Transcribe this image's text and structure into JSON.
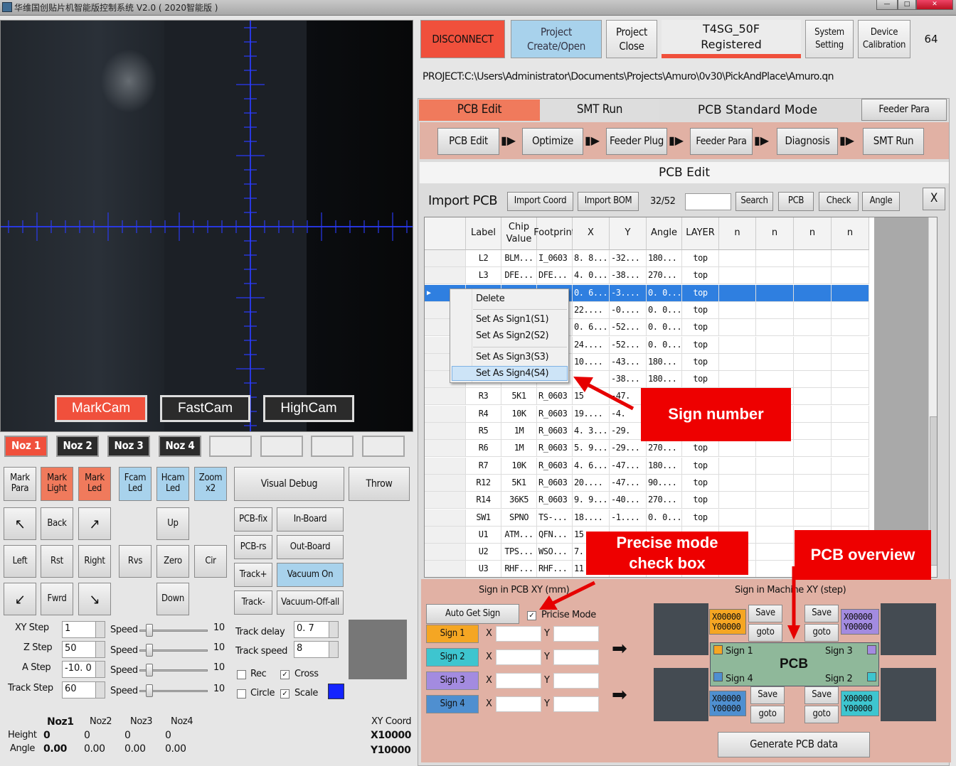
{
  "window": {
    "title": "华维国创贴片机智能版控制系统 V2.0 ( 2020智能版 )"
  },
  "camera": {
    "tabs": [
      "MarkCam",
      "FastCam",
      "HighCam"
    ],
    "active_tab": "MarkCam"
  },
  "nozzles": {
    "buttons": [
      "Noz 1",
      "Noz 2",
      "Noz 3",
      "Noz 4"
    ],
    "active": "Noz 1"
  },
  "lights": {
    "mark_para": "Mark\nPara",
    "mark_light": "Mark\nLight",
    "mark_led": "Mark\nLed",
    "fcam_led": "Fcam\nLed",
    "hcam_led": "Hcam\nLed",
    "zoom": "Zoom\nx2",
    "visual_debug": "Visual Debug",
    "throw": "Throw"
  },
  "jog": {
    "back": "Back",
    "up": "Up",
    "left": "Left",
    "rst": "Rst",
    "right": "Right",
    "rvs": "Rvs",
    "zero": "Zero",
    "cir": "Cir",
    "fwrd": "Fwrd",
    "down": "Down"
  },
  "side_buttons": {
    "pcb_fix": "PCB-fix",
    "in_board": "In-Board",
    "pcb_rs": "PCB-rs",
    "out_board": "Out-Board",
    "track_plus": "Track+",
    "vacuum_on": "Vacuum On",
    "track_minus": "Track-",
    "vacuum_off_all": "Vacuum-Off-all"
  },
  "steps": [
    {
      "label": "XY Step",
      "value": "1",
      "speed_label": "Speed",
      "speed": "10"
    },
    {
      "label": "Z Step",
      "value": "50",
      "speed_label": "Speed",
      "speed": "10"
    },
    {
      "label": "A Step",
      "value": "-10. 0",
      "speed_label": "Speed",
      "speed": "10"
    },
    {
      "label": "Track Step",
      "value": "60",
      "speed_label": "Speed",
      "speed": "10"
    }
  ],
  "track": {
    "delay_label": "Track delay",
    "delay": "0. 7",
    "speed_label": "Track speed",
    "speed": "8"
  },
  "checks": {
    "rec": "Rec",
    "rec_checked": false,
    "cross": "Cross",
    "cross_checked": true,
    "circle": "Circle",
    "circle_checked": false,
    "scale": "Scale",
    "scale_checked": true
  },
  "status": {
    "headers": [
      "Noz1",
      "Noz2",
      "Noz3",
      "Noz4"
    ],
    "height_label": "Height",
    "angle_label": "Angle",
    "heights": [
      "0",
      "0",
      "0",
      "0"
    ],
    "angles": [
      "0.00",
      "0.00",
      "0.00",
      "0.00"
    ],
    "xy_label": "XY Coord",
    "x": "X10000",
    "y": "Y10000"
  },
  "toolbar": {
    "disconnect": "DISCONNECT",
    "project_create": "Project\nCreate/Open",
    "project_close": "Project\nClose",
    "machine": "T4SG_50F\nRegistered",
    "system_setting": "System\nSetting",
    "device_calibration": "Device\nCalibration",
    "count": "64"
  },
  "project_path": "PROJECT:C:\\Users\\Administrator\\Documents\\Projects\\Amuro\\0v30\\PickAndPlace\\Amuro.qn",
  "main_tabs": [
    "PCB Edit",
    "SMT Run",
    "PCB Standard Mode",
    "Feeder Para"
  ],
  "workflow": [
    "PCB Edit",
    "Optimize",
    "Feeder Plug",
    "Feeder Para",
    "Diagnosis",
    "SMT Run"
  ],
  "section_title": "PCB Edit",
  "import": {
    "title": "Import PCB",
    "import_coord": "Import Coord",
    "import_bom": "Import BOM",
    "counter": "32/52",
    "search_value": "",
    "search": "Search",
    "pcb": "PCB",
    "check": "Check",
    "angle": "Angle",
    "close": "X"
  },
  "grid": {
    "headers": [
      "Label",
      "Chip\nValue",
      "Footprint",
      "X",
      "Y",
      "Angle",
      "LAYER",
      "n",
      "n",
      "n",
      "n"
    ],
    "rows": [
      [
        "L2",
        "BLM...",
        "I_0603",
        "8. 8...",
        "-32...",
        "180...",
        "top"
      ],
      [
        "L3",
        "DFE...",
        "DFE...",
        "4. 0...",
        "-38...",
        "270...",
        "top"
      ],
      [
        "",
        "",
        "",
        "0. 6...",
        "-3....",
        "0. 0...",
        "top"
      ],
      [
        "",
        "",
        "",
        "22....",
        "-0....",
        "0. 0...",
        "top"
      ],
      [
        "",
        "",
        "",
        "0. 6...",
        "-52...",
        "0. 0...",
        "top"
      ],
      [
        "",
        "",
        "",
        "24....",
        "-52...",
        "0. 0...",
        "top"
      ],
      [
        "",
        "",
        "",
        "10....",
        "-43...",
        "180...",
        "top"
      ],
      [
        "",
        "",
        "",
        "",
        "-38...",
        "180...",
        "top"
      ],
      [
        "R3",
        "5K1",
        "R_0603",
        "15",
        "-47.",
        "",
        ""
      ],
      [
        "R4",
        "10K",
        "R_0603",
        "19....",
        "-4.",
        "",
        ""
      ],
      [
        "R5",
        "1M",
        "R_0603",
        "4. 3...",
        "-29.",
        "",
        ""
      ],
      [
        "R6",
        "1M",
        "R_0603",
        "5. 9...",
        "-29...",
        "270...",
        "top"
      ],
      [
        "R7",
        "10K",
        "R_0603",
        "4. 6...",
        "-47...",
        "180...",
        "top"
      ],
      [
        "R12",
        "5K1",
        "R_0603",
        "20....",
        "-47...",
        "90....",
        "top"
      ],
      [
        "R14",
        "36K5",
        "R_0603",
        "9. 9...",
        "-40...",
        "270...",
        "top"
      ],
      [
        "SW1",
        "SPNO",
        "TS-...",
        "18....",
        "-1....",
        "0. 0...",
        "top"
      ],
      [
        "U1",
        "ATM...",
        "QFN...",
        "15",
        "",
        "",
        ""
      ],
      [
        "U2",
        "TPS...",
        "WSO...",
        "7.",
        "",
        "",
        ""
      ],
      [
        "U3",
        "RHF...",
        "RHF...",
        "11",
        "",
        "",
        ""
      ]
    ],
    "selected_row": 2
  },
  "context_menu": [
    "Delete",
    "Set As Sign1(S1)",
    "Set As Sign2(S2)",
    "Set As Sign3(S3)",
    "Set As Sign4(S4)"
  ],
  "sign_pcb": {
    "title": "Sign in PCB XY (mm)",
    "auto": "Auto Get Sign",
    "precise_label": "Pricise Mode",
    "precise_checked": true,
    "signs": [
      "Sign 1",
      "Sign 2",
      "Sign 3",
      "Sign 4"
    ],
    "x_label": "X",
    "y_label": "Y"
  },
  "sign_machine": {
    "title": "Sign in Machine XY (step)",
    "save": "Save",
    "goto": "goto",
    "coord": "X00000\nY00000",
    "pcb": "PCB",
    "sign1": "Sign 1",
    "sign2": "Sign 2",
    "sign3": "Sign 3",
    "sign4": "Sign 4",
    "generate": "Generate PCB data"
  },
  "annotations": {
    "sign_number": "Sign number",
    "precise": "Precise mode\ncheck box",
    "overview": "PCB overview"
  },
  "colors": {
    "accent_red": "#f0503c",
    "blue_button": "#a8d2ec",
    "sign1": "#f5a623",
    "sign2": "#3ec5cf",
    "sign3": "#a38be0",
    "sign4": "#4f8fd0",
    "selected_row": "#2f7fe0",
    "callout": "#e60000"
  }
}
